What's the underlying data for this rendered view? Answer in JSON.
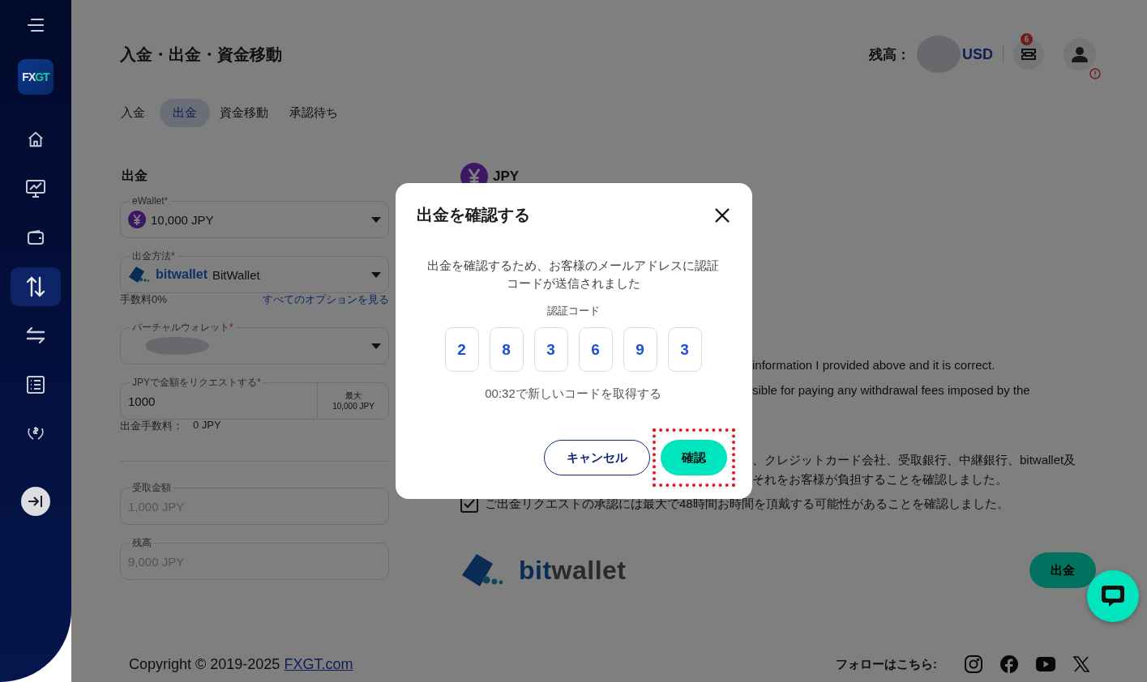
{
  "sidebar": {
    "logo": {
      "part_1": "FX",
      "part_2": "GT"
    },
    "nav_items": [
      {
        "kind": "home",
        "selected": false
      },
      {
        "kind": "chart",
        "selected": false
      },
      {
        "kind": "wallet",
        "selected": false
      },
      {
        "kind": "transfer",
        "selected": true
      },
      {
        "kind": "swap",
        "selected": false
      },
      {
        "kind": "list",
        "selected": false
      },
      {
        "kind": "support",
        "selected": false
      }
    ]
  },
  "header": {
    "title": "入金・出金・資金移動",
    "balance_label": "残高：",
    "balance_currency": "USD",
    "notification_count": "6"
  },
  "tabs": [
    {
      "label": "入金",
      "selected": false
    },
    {
      "label": "出金",
      "selected": true
    },
    {
      "label": "資金移動",
      "selected": false
    },
    {
      "label": "承認待ち",
      "selected": false
    }
  ],
  "form": {
    "title": "出金",
    "ewallet": {
      "label": "eWallet",
      "required_mark": "*",
      "value": "10,000 JPY"
    },
    "method": {
      "label": "出金方法",
      "required_mark": "*",
      "brand": "bitwallet",
      "value": "BitWallet"
    },
    "fee_rate": "手数料0%",
    "options_link": "すべてのオプションを見る",
    "virtual_wallet": {
      "label": "バーチャルウォレット",
      "required_mark": "*"
    },
    "amount": {
      "label": "JPYで金額をリクエストする",
      "required_mark": "*",
      "value": "1000",
      "max_label": "最大",
      "max_value": "10,000 JPY"
    },
    "fee": {
      "label": "出金手数料：",
      "value": "0 JPY"
    },
    "received": {
      "label": "受取金額",
      "value": "1,000 JPY",
      "disabled": true
    },
    "balance": {
      "label": "残高",
      "value": "9,000 JPY",
      "disabled": true
    }
  },
  "details": {
    "currency": "JPY",
    "visible_lines": [
      "information I provided above and it is correct.",
      "sible for paying any withdrawal fees imposed by the",
      "、クレジットカード会社、受取銀行、中継銀行、bitwallet及",
      "それをお客様が負担することを確認しました。"
    ],
    "confirm_checkbox": {
      "label": "ご出金リクエストの承認には最大で48時間お時間を頂戴する可能性があることを確認しました。",
      "checked": true
    },
    "brand_logo": {
      "part_1": "bit",
      "part_2": "wallet"
    },
    "submit_button": "出金"
  },
  "footer": {
    "copyright": "Copyright © 2019-2025",
    "copyright_link": "FXGT.com",
    "follow_label": "フォローはこちら:",
    "social_links": [
      {
        "kind": "instagram"
      },
      {
        "kind": "facebook"
      },
      {
        "kind": "youtube"
      },
      {
        "kind": "x"
      }
    ]
  },
  "modal": {
    "title": "出金を確認する",
    "message": "出金を確認するため、お客様のメールアドレスに認証コードが送信されました",
    "code_label": "認証コード",
    "code_digits": [
      "2",
      "8",
      "3",
      "6",
      "9",
      "3"
    ],
    "resend": "00:32で新しいコードを取得する",
    "cancel_button": "キャンセル",
    "confirm_button": "確認",
    "confirm_highlighted": true
  }
}
